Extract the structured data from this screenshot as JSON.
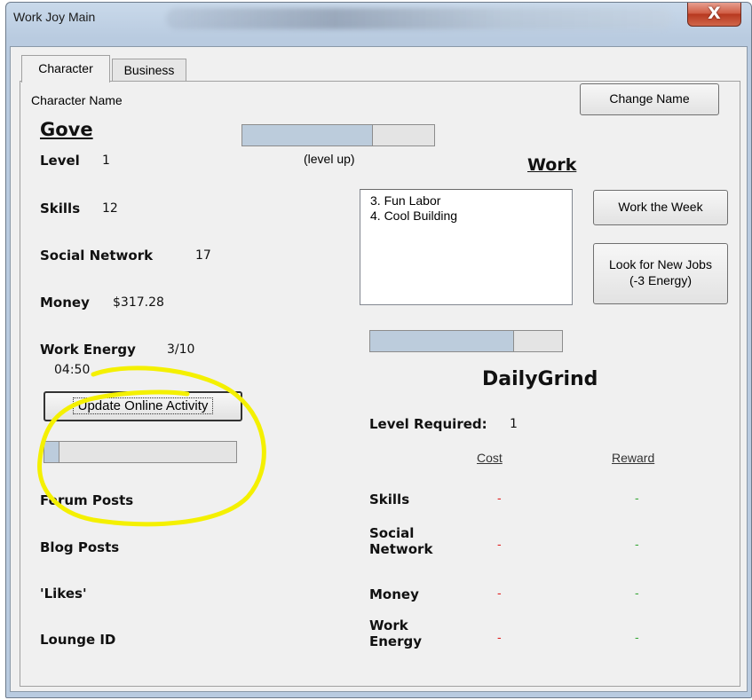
{
  "window": {
    "title": "Work Joy Main",
    "close_glyph": "X"
  },
  "tabs": [
    {
      "label": "Character"
    },
    {
      "label": "Business"
    }
  ],
  "character": {
    "name_caption": "Character Name",
    "name": "Gove",
    "change_name_button": "Change Name",
    "level_progress": 0.68,
    "level_up_text": "(level up)",
    "stats": {
      "level": {
        "label": "Level",
        "value": "1"
      },
      "skills": {
        "label": "Skills",
        "value": "12"
      },
      "social_network": {
        "label": "Social Network",
        "value": "17"
      },
      "money": {
        "label": "Money",
        "value": "$317.28"
      },
      "work_energy": {
        "label": "Work Energy",
        "value": "3/10",
        "timer": "04:50"
      }
    },
    "update_button": "Update Online Activity",
    "activity_progress": 0.08,
    "online": [
      {
        "label": "Forum Posts"
      },
      {
        "label": "Blog Posts"
      },
      {
        "label": "'Likes'"
      },
      {
        "label": "Lounge ID"
      }
    ]
  },
  "work": {
    "heading": "Work",
    "jobs": [
      "3. Fun Labor",
      "4. Cool Building"
    ],
    "work_week_button": "Work the Week",
    "look_jobs_button_line1": "Look for New Jobs",
    "look_jobs_button_line2": "(-3 Energy)",
    "work_progress": 0.75,
    "job_name": "DailyGrind",
    "level_required_label": "Level Required:",
    "level_required_value": "1",
    "cost_header": "Cost",
    "reward_header": "Reward",
    "rows": [
      {
        "label": "Skills",
        "cost": "-",
        "reward": "-"
      },
      {
        "label_line1": "Social",
        "label_line2": "Network",
        "cost": "-",
        "reward": "-"
      },
      {
        "label": "Money",
        "cost": "-",
        "reward": "-"
      },
      {
        "label_line1": "Work",
        "label_line2": "Energy",
        "cost": "-",
        "reward": "-"
      }
    ]
  },
  "colors": {
    "highlight": "#f4f000",
    "cost": "#e02020",
    "reward": "#3aa83a"
  }
}
